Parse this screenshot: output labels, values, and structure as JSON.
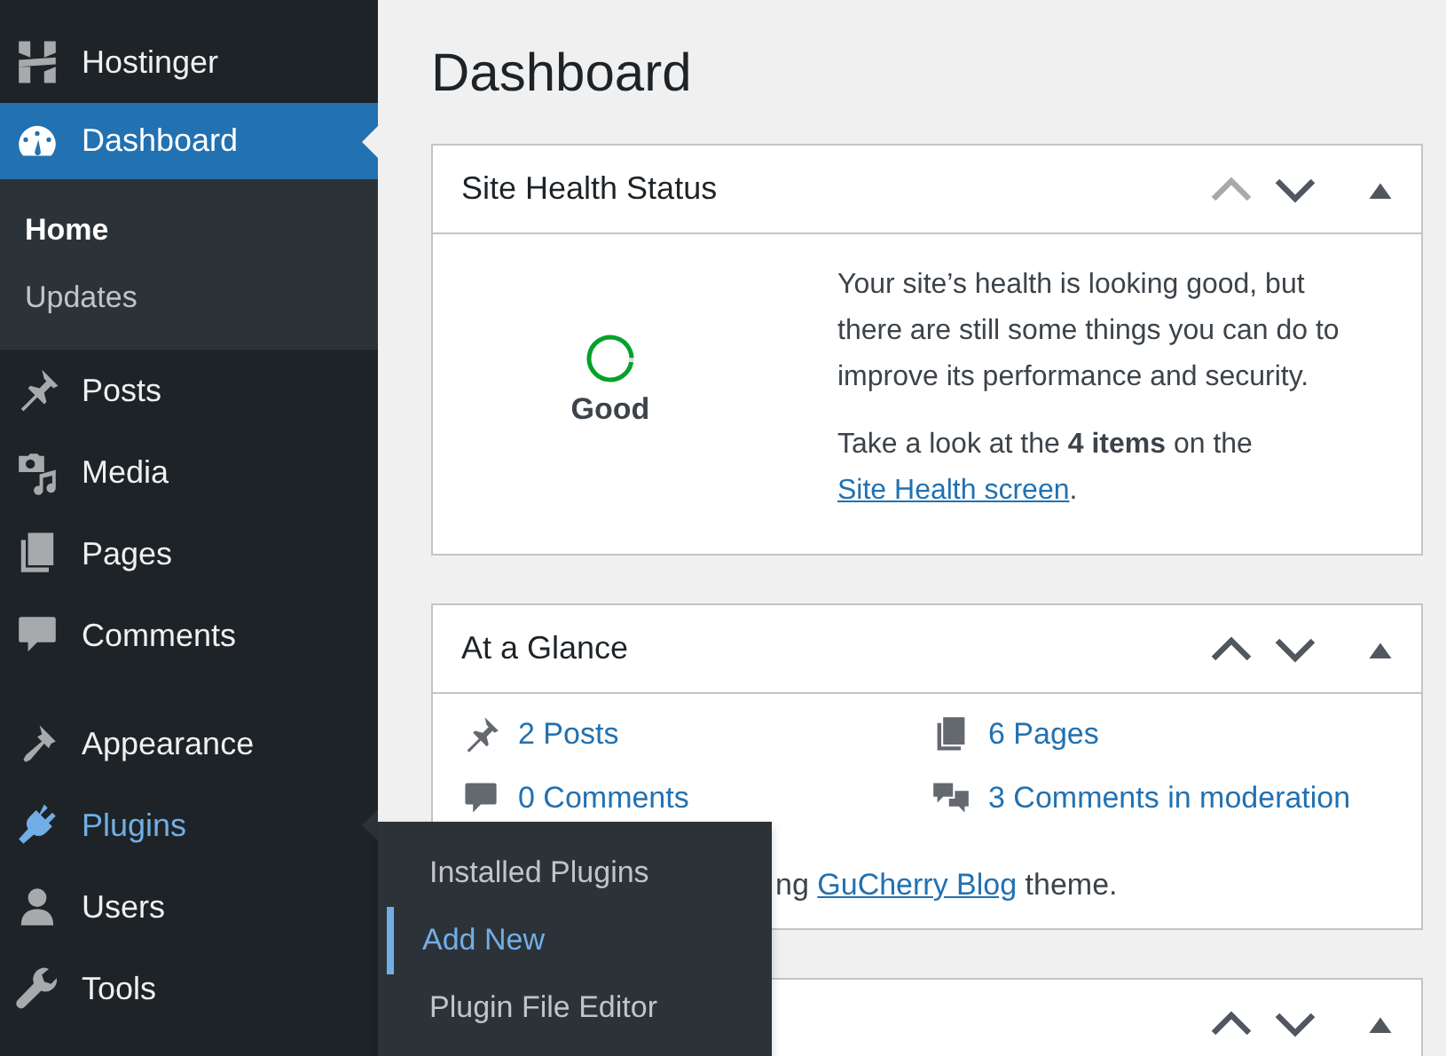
{
  "sidebar": {
    "groups": [
      [
        {
          "label": "Hostinger",
          "selected": false,
          "highlighted": false
        },
        {
          "label": "Dashboard",
          "selected": true,
          "highlighted": false,
          "children": [
            {
              "label": "Home",
              "selected": true
            },
            {
              "label": "Updates",
              "selected": false
            }
          ]
        }
      ],
      [
        {
          "label": "Posts",
          "selected": false,
          "highlighted": false
        },
        {
          "label": "Media",
          "selected": false,
          "highlighted": false
        },
        {
          "label": "Pages",
          "selected": false,
          "highlighted": false
        },
        {
          "label": "Comments",
          "selected": false,
          "highlighted": false
        }
      ],
      [
        {
          "label": "Appearance",
          "selected": false,
          "highlighted": false
        },
        {
          "label": "Plugins",
          "selected": false,
          "highlighted": true
        },
        {
          "label": "Users",
          "selected": false,
          "highlighted": false
        },
        {
          "label": "Tools",
          "selected": false,
          "highlighted": false
        }
      ]
    ]
  },
  "flyout": {
    "items": [
      {
        "label": "Installed Plugins",
        "selected": false
      },
      {
        "label": "Add New",
        "selected": true
      },
      {
        "label": "Plugin File Editor",
        "selected": false
      }
    ]
  },
  "page_title": "Dashboard",
  "widgets": [
    {
      "kind": "health",
      "title": "Site Health Status",
      "controls": [
        {
          "kind": "up",
          "disabled": true
        },
        {
          "kind": "down",
          "disabled": false
        },
        {
          "kind": "toggle",
          "disabled": false
        }
      ],
      "status": "Good",
      "level": 0.96,
      "paragraphs": [
        {
          "text": "Your site’s health is looking good, but there are still some things you can do to improve its performance and security."
        },
        {
          "text": "Take a look at the **4 items** on the",
          "link": "Site Health screen",
          "after": "."
        }
      ]
    },
    {
      "kind": "glance",
      "title": "At a Glance",
      "controls": [
        {
          "kind": "up",
          "disabled": false
        },
        {
          "kind": "down",
          "disabled": false
        },
        {
          "kind": "toggle",
          "disabled": false
        }
      ],
      "items": [
        {
          "label": "2 Posts"
        },
        {
          "label": "6 Pages"
        },
        {
          "label": "0 Comments"
        },
        {
          "label": "3 Comments in moderation"
        }
      ],
      "theme_line": {
        "before": "ng",
        "link": "GuCherry Blog",
        "after": "theme."
      }
    },
    {
      "kind": "empty",
      "controls": [
        {
          "kind": "up",
          "disabled": false
        },
        {
          "kind": "down",
          "disabled": false
        },
        {
          "kind": "toggle",
          "disabled": false
        }
      ]
    }
  ]
}
